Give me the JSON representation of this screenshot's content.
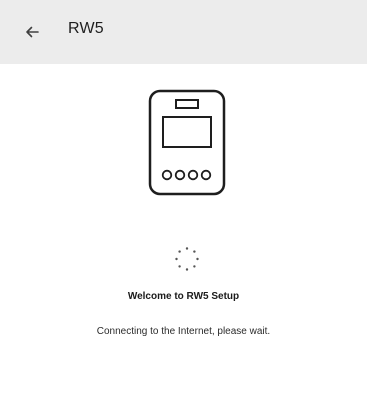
{
  "header": {
    "title": "RW5",
    "back_icon": "arrow-left-icon"
  },
  "illustration": {
    "icon": "device-icon"
  },
  "loading": {
    "icon": "loading-spinner-icon"
  },
  "content": {
    "title": "Welcome to RW5 Setup",
    "message": "Connecting to the Internet, please wait."
  },
  "colors": {
    "app_bar": "#ececec",
    "background": "#ffffff",
    "text": "#1b1b1b"
  }
}
